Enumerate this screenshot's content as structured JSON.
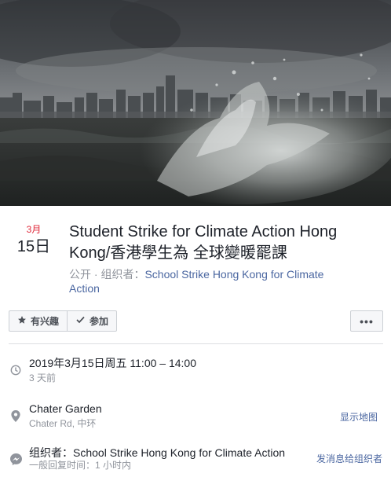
{
  "event": {
    "month": "3月",
    "day": "15日",
    "title_line1": "Student Strike for Climate Action Hong",
    "title_line2": "Kong/香港學生為 全球變暖罷課",
    "privacy": "公开",
    "separator": " · ",
    "organizer_prefix": "组织者：",
    "organizer_line1": "School Strike Hong Kong for Climate",
    "organizer_line2": "Action"
  },
  "actions": {
    "interested_label": "有兴趣",
    "going_label": "参加",
    "more_label": "•••",
    "interested_icon": "star-icon",
    "going_icon": "checkmark-icon"
  },
  "details": {
    "time": {
      "icon": "clock-icon",
      "main": "2019年3月15日周五 11:00 – 14:00",
      "sub": "3 天前"
    },
    "location": {
      "icon": "map-pin-icon",
      "main": "Chater Garden",
      "sub": "Chater Rd, 中环",
      "action": "显示地图"
    },
    "organizer": {
      "icon": "messenger-icon",
      "main": "组织者：School Strike Hong Kong for Climate Action",
      "sub": "一般回复时间：1 小时内",
      "action": "发消息给组织者"
    }
  },
  "colors": {
    "accent_red": "#e0293a",
    "link_blue": "#4b67a1",
    "muted_gray": "#90949c"
  }
}
